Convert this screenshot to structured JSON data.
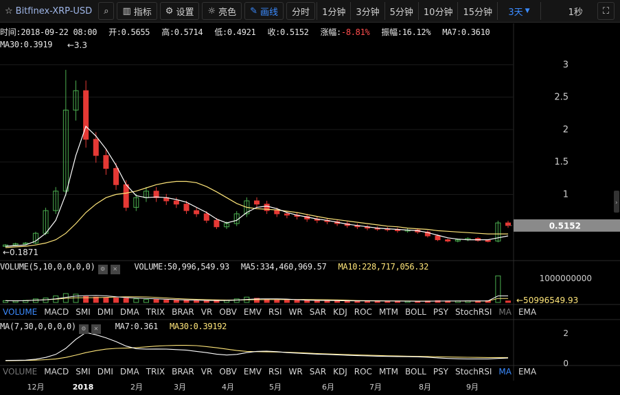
{
  "toolbar": {
    "symbol": "Bitfinex-XRP-USD",
    "indicators_label": "指标",
    "settings_label": "设置",
    "theme_label": "亮色",
    "draw_label": "画线",
    "intervals": [
      "分时",
      "1分钟",
      "3分钟",
      "5分钟",
      "10分钟",
      "15分钟"
    ],
    "selected_interval": "3天",
    "refresh_label": "1秒",
    "icons": {
      "favorite": "star-icon",
      "search": "search-icon",
      "indicators": "chart-icon",
      "settings": "gear-icon",
      "theme": "sun-icon",
      "draw": "pencil-icon",
      "fullscreen": "fullscreen-icon"
    }
  },
  "info": {
    "time": "时间:2018-09-22 08:00",
    "open": "开:0.5655",
    "high": "高:0.5714",
    "low": "低:0.4921",
    "close": "收:0.5152",
    "change_label": "涨幅:",
    "change_value": "-8.81%",
    "amplitude": "振幅:16.12%",
    "ma7": "MA7:0.3610",
    "ma30": "MA30:0.3919"
  },
  "price_panel": {
    "max_marker": "←3.3",
    "min_marker": "←0.1871",
    "last_price": "0.5152",
    "y_ticks": [
      "3",
      "2.5",
      "2",
      "1.5",
      "1"
    ]
  },
  "volume_panel": {
    "label": "VOLUME(5,10,0,0,0,0)",
    "volume": "VOLUME:50,996,549.93",
    "ma5": "MA5:334,460,969.57",
    "ma10": "MA10:228,717,056.32",
    "y_tick": "1000000000",
    "last_marker": "←50996549.93"
  },
  "indicator_tabs": [
    "VOLUME",
    "MACD",
    "SMI",
    "DMI",
    "DMA",
    "TRIX",
    "BRAR",
    "VR",
    "OBV",
    "EMV",
    "RSI",
    "WR",
    "SAR",
    "KDJ",
    "ROC",
    "MTM",
    "BOLL",
    "PSY",
    "StochRSI",
    "MA",
    "EMA"
  ],
  "ma_panel": {
    "label": "MA(7,30,0,0,0,0)",
    "ma7": "MA7:0.361",
    "ma30": "MA30:0.39192",
    "y_ticks": [
      "2",
      "0"
    ]
  },
  "x_axis": [
    "12月",
    "2018",
    "2月",
    "3月",
    "4月",
    "5月",
    "6月",
    "7月",
    "8月",
    "9月"
  ],
  "colors": {
    "up": "#4caf50",
    "down": "#e53935",
    "ma7": "#ffffff",
    "ma30": "#ffe67a",
    "accent": "#3b8bff"
  },
  "chart_data": {
    "type": "candlestick",
    "title": "",
    "x": [
      "2017-11-25",
      "2017-12-01",
      "2017-12-07",
      "2017-12-13",
      "2017-12-19",
      "2017-12-25",
      "2017-12-31",
      "2018-01-06",
      "2018-01-12",
      "2018-01-18",
      "2018-01-24",
      "2018-01-30",
      "2018-02-05",
      "2018-02-11",
      "2018-02-17",
      "2018-02-23",
      "2018-03-01",
      "2018-03-07",
      "2018-03-13",
      "2018-03-19",
      "2018-03-25",
      "2018-03-31",
      "2018-04-06",
      "2018-04-12",
      "2018-04-18",
      "2018-04-24",
      "2018-04-30",
      "2018-05-06",
      "2018-05-12",
      "2018-05-18",
      "2018-05-24",
      "2018-05-30",
      "2018-06-05",
      "2018-06-11",
      "2018-06-17",
      "2018-06-23",
      "2018-06-29",
      "2018-07-05",
      "2018-07-11",
      "2018-07-17",
      "2018-07-23",
      "2018-07-29",
      "2018-08-04",
      "2018-08-10",
      "2018-08-16",
      "2018-08-22",
      "2018-08-28",
      "2018-09-03",
      "2018-09-09",
      "2018-09-15",
      "2018-09-22"
    ],
    "series": [
      {
        "name": "close",
        "values": [
          0.22,
          0.24,
          0.25,
          0.4,
          0.75,
          1.05,
          2.3,
          2.6,
          1.85,
          1.6,
          1.4,
          1.15,
          0.8,
          0.95,
          1.05,
          0.95,
          0.9,
          0.85,
          0.75,
          0.7,
          0.6,
          0.5,
          0.55,
          0.7,
          0.9,
          0.85,
          0.75,
          0.7,
          0.68,
          0.66,
          0.62,
          0.6,
          0.58,
          0.55,
          0.52,
          0.5,
          0.48,
          0.47,
          0.46,
          0.44,
          0.45,
          0.42,
          0.36,
          0.3,
          0.28,
          0.3,
          0.32,
          0.29,
          0.28,
          0.56,
          0.52
        ]
      },
      {
        "name": "MA7",
        "values": [
          0.2,
          0.21,
          0.22,
          0.28,
          0.4,
          0.6,
          1.0,
          1.6,
          2.05,
          1.9,
          1.7,
          1.45,
          1.15,
          0.98,
          0.95,
          0.96,
          0.95,
          0.92,
          0.88,
          0.8,
          0.72,
          0.62,
          0.56,
          0.6,
          0.72,
          0.8,
          0.82,
          0.78,
          0.72,
          0.68,
          0.65,
          0.62,
          0.6,
          0.57,
          0.54,
          0.52,
          0.5,
          0.48,
          0.47,
          0.46,
          0.45,
          0.44,
          0.41,
          0.37,
          0.33,
          0.31,
          0.3,
          0.3,
          0.3,
          0.33,
          0.36
        ]
      },
      {
        "name": "MA30",
        "values": [
          0.18,
          0.19,
          0.2,
          0.22,
          0.25,
          0.3,
          0.4,
          0.55,
          0.72,
          0.85,
          0.95,
          1.0,
          1.02,
          1.05,
          1.1,
          1.15,
          1.18,
          1.2,
          1.2,
          1.18,
          1.12,
          1.04,
          0.95,
          0.86,
          0.8,
          0.78,
          0.77,
          0.76,
          0.74,
          0.72,
          0.69,
          0.66,
          0.63,
          0.61,
          0.59,
          0.57,
          0.55,
          0.53,
          0.51,
          0.5,
          0.48,
          0.47,
          0.46,
          0.44,
          0.43,
          0.42,
          0.41,
          0.4,
          0.39,
          0.39,
          0.39
        ]
      }
    ],
    "ylim": [
      0,
      3.3
    ],
    "volume_ylim": [
      0,
      1200000000
    ]
  }
}
